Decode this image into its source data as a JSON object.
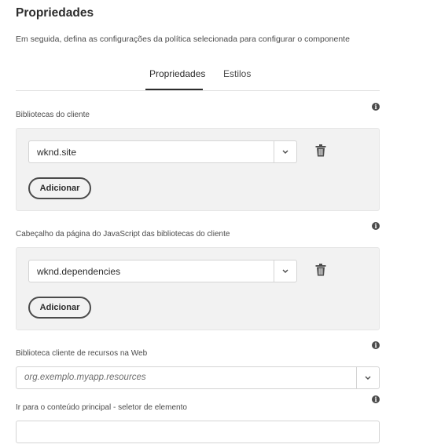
{
  "header": {
    "title": "Propriedades",
    "subtitle": "Em seguida, defina as configurações da política selecionada para configurar o componente"
  },
  "tabs": [
    {
      "label": "Propriedades",
      "active": true
    },
    {
      "label": "Estilos",
      "active": false
    }
  ],
  "client_libraries": {
    "label": "Bibliotecas do cliente",
    "value": "wknd.site",
    "add_label": "Adicionar"
  },
  "head_libraries": {
    "label": "Cabeçalho da página do JavaScript das bibliotecas do cliente",
    "value": "wknd.dependencies",
    "add_label": "Adicionar"
  },
  "web_resources": {
    "label": "Biblioteca cliente de recursos na Web",
    "placeholder": "org.exemplo.myapp.resources"
  },
  "skip_to_main": {
    "label": "Ir para o conteúdo principal - seletor de elemento",
    "value": ""
  },
  "icons": {
    "info": "info-icon",
    "chevron": "chevron-down-icon",
    "trash": "trash-icon"
  }
}
